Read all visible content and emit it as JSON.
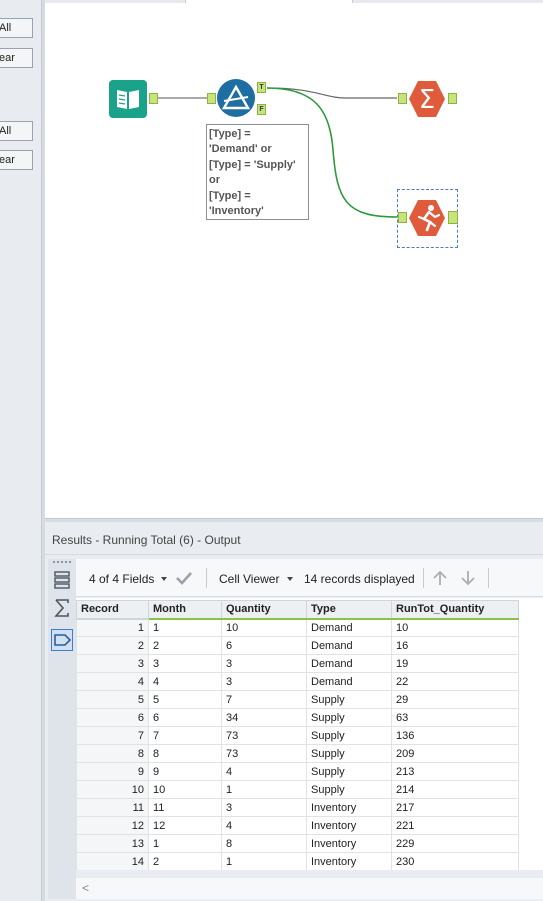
{
  "left_panel": {
    "buttons": [
      "All",
      "ear",
      "All",
      "ear"
    ]
  },
  "canvas": {
    "annotation": "[Type] =\n'Demand' or\n[Type] = 'Supply'\nor\n[Type] =\n'Inventory'",
    "filter_true_label": "T",
    "filter_false_label": "F",
    "sum_symbol": "Σ",
    "colors": {
      "input_tool": "#1aa38a",
      "filter_tool": "#1f6ea3",
      "summarize_tool": "#e05a3c",
      "running_total_tool": "#e05a3c",
      "true_connection": "#2e9a3c",
      "connection": "#777777"
    }
  },
  "results": {
    "title": "Results - Running Total (6) - Output",
    "fields_label": "4 of 4 Fields",
    "viewer_label": "Cell Viewer",
    "records_label": "14 records displayed",
    "columns": [
      "Record",
      "Month",
      "Quantity",
      "Type",
      "RunTot_Quantity"
    ],
    "rows": [
      [
        "1",
        "1",
        "10",
        "Demand",
        "10"
      ],
      [
        "2",
        "2",
        "6",
        "Demand",
        "16"
      ],
      [
        "3",
        "3",
        "3",
        "Demand",
        "19"
      ],
      [
        "4",
        "4",
        "3",
        "Demand",
        "22"
      ],
      [
        "5",
        "5",
        "7",
        "Supply",
        "29"
      ],
      [
        "6",
        "6",
        "34",
        "Supply",
        "63"
      ],
      [
        "7",
        "7",
        "73",
        "Supply",
        "136"
      ],
      [
        "8",
        "8",
        "73",
        "Supply",
        "209"
      ],
      [
        "9",
        "9",
        "4",
        "Supply",
        "213"
      ],
      [
        "10",
        "10",
        "1",
        "Supply",
        "214"
      ],
      [
        "11",
        "11",
        "3",
        "Inventory",
        "217"
      ],
      [
        "12",
        "12",
        "4",
        "Inventory",
        "221"
      ],
      [
        "13",
        "1",
        "8",
        "Inventory",
        "229"
      ],
      [
        "14",
        "2",
        "1",
        "Inventory",
        "230"
      ]
    ]
  }
}
